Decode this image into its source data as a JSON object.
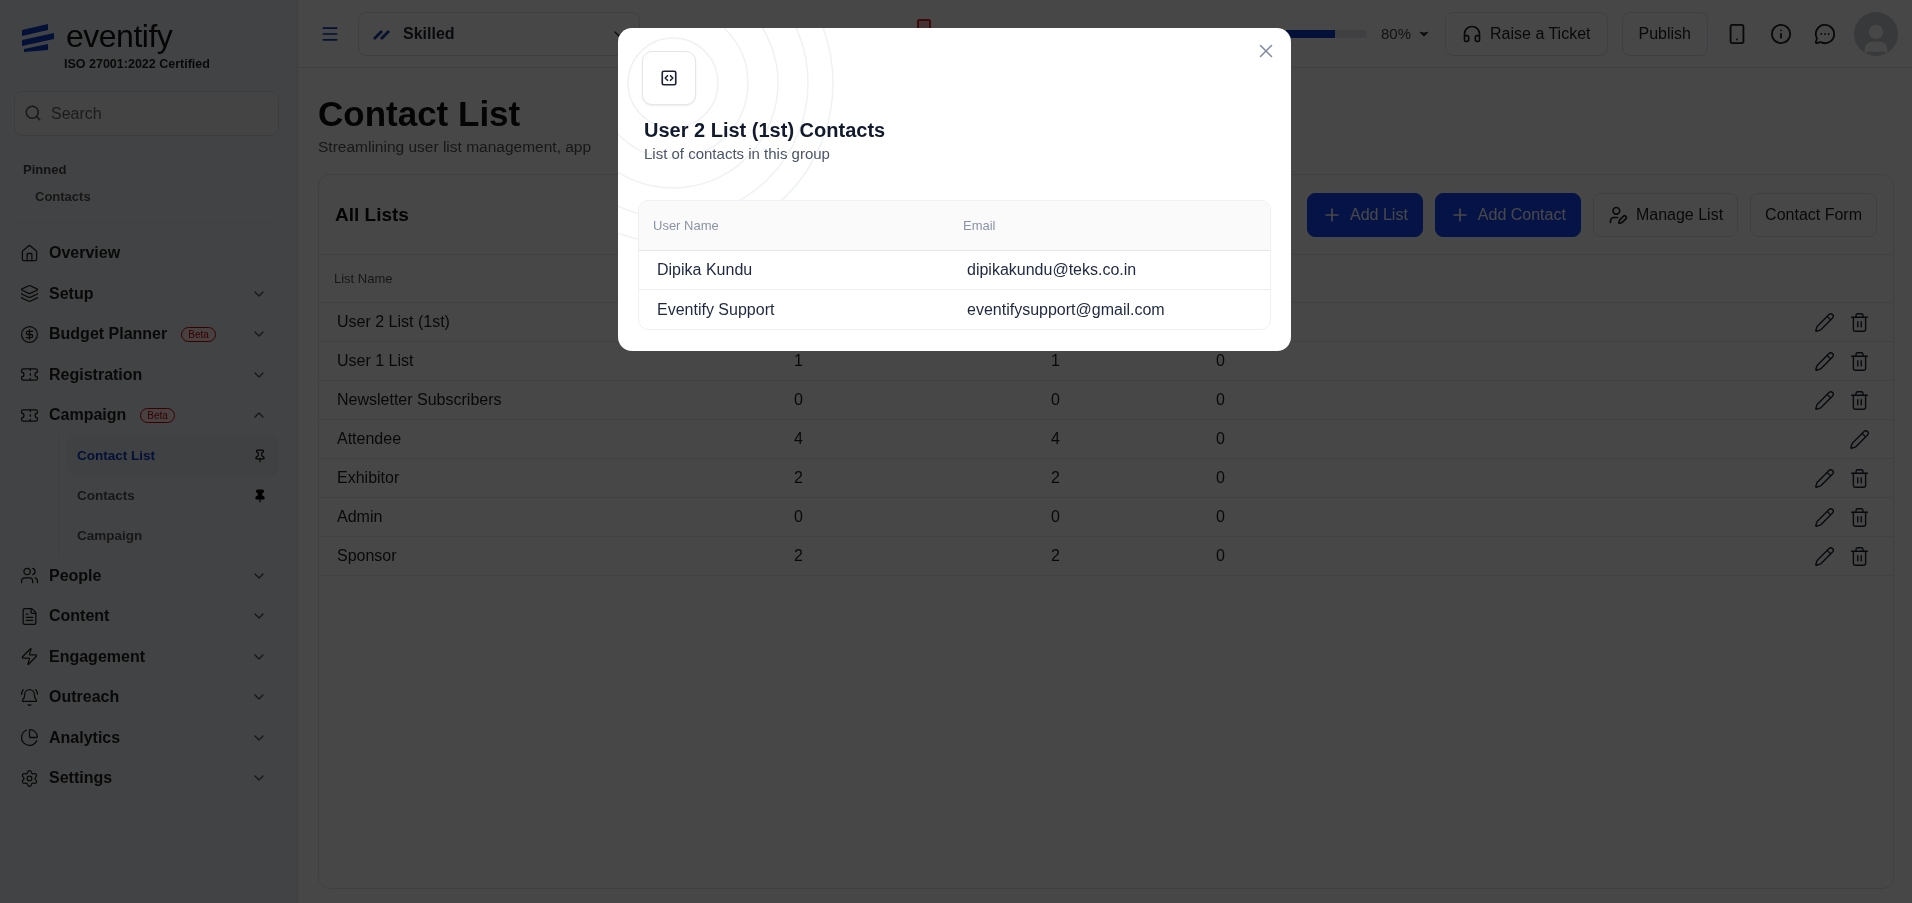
{
  "brand": {
    "name": "eventify",
    "certification": "ISO 27001:2022 Certified"
  },
  "sidebar": {
    "search": {
      "placeholder": "Search"
    },
    "pinned": {
      "title": "Pinned",
      "items": [
        "Contacts"
      ]
    },
    "items": [
      {
        "label": "Overview"
      },
      {
        "label": "Setup",
        "expanded": false
      },
      {
        "label": "Budget Planner",
        "badge": "Beta",
        "expanded": false
      },
      {
        "label": "Registration",
        "expanded": false
      },
      {
        "label": "Campaign",
        "badge": "Beta",
        "expanded": true,
        "children": [
          {
            "label": "Contact List",
            "selected": true,
            "pinned": false
          },
          {
            "label": "Contacts",
            "selected": false,
            "pinned": true
          },
          {
            "label": "Campaign",
            "selected": false
          }
        ]
      },
      {
        "label": "People",
        "expanded": false
      },
      {
        "label": "Content",
        "expanded": false
      },
      {
        "label": "Engagement",
        "expanded": false
      },
      {
        "label": "Outreach",
        "expanded": false
      },
      {
        "label": "Analytics",
        "expanded": false
      },
      {
        "label": "Settings",
        "expanded": false
      }
    ]
  },
  "topbar": {
    "project": "Skilled",
    "progress": {
      "level": 0.8,
      "reading": "80%"
    },
    "buttons": [
      "Raise a Ticket",
      "Publish"
    ]
  },
  "page": {
    "title": "Contact List",
    "subtitle": "Streamlining user list management, app"
  },
  "lists_card": {
    "title": "All Lists",
    "buttons": [
      {
        "label": "Add List",
        "kind": "primary"
      },
      {
        "label": "Add Contact",
        "kind": "primary"
      },
      {
        "label": "Manage List",
        "kind": "icon"
      },
      {
        "label": "Contact Form",
        "kind": "plain"
      }
    ],
    "columns": [
      "List Name"
    ],
    "rows": [
      {
        "name": "User 2 List (1st)",
        "values": [],
        "deletable": true
      },
      {
        "name": "User 1 List",
        "values": [
          "1",
          "1",
          "0"
        ],
        "deletable": true
      },
      {
        "name": "Newsletter Subscribers",
        "values": [
          "0",
          "0",
          "0"
        ],
        "deletable": true
      },
      {
        "name": "Attendee",
        "values": [
          "4",
          "4",
          "0"
        ],
        "deletable": false
      },
      {
        "name": "Exhibitor",
        "values": [
          "2",
          "2",
          "0"
        ],
        "deletable": true
      },
      {
        "name": "Admin",
        "values": [
          "0",
          "0",
          "0"
        ],
        "deletable": true
      },
      {
        "name": "Sponsor",
        "values": [
          "2",
          "2",
          "0"
        ],
        "deletable": true
      }
    ]
  },
  "dialog": {
    "title": "User 2 List (1st) Contacts",
    "subtitle": "List of contacts in this group",
    "columns": [
      "User Name",
      "Email"
    ],
    "rows": [
      [
        "Dipika Kundu",
        "dipikakundu@teks.co.in"
      ],
      [
        "Eventify Support",
        "eventifysupport@gmail.com"
      ]
    ]
  }
}
